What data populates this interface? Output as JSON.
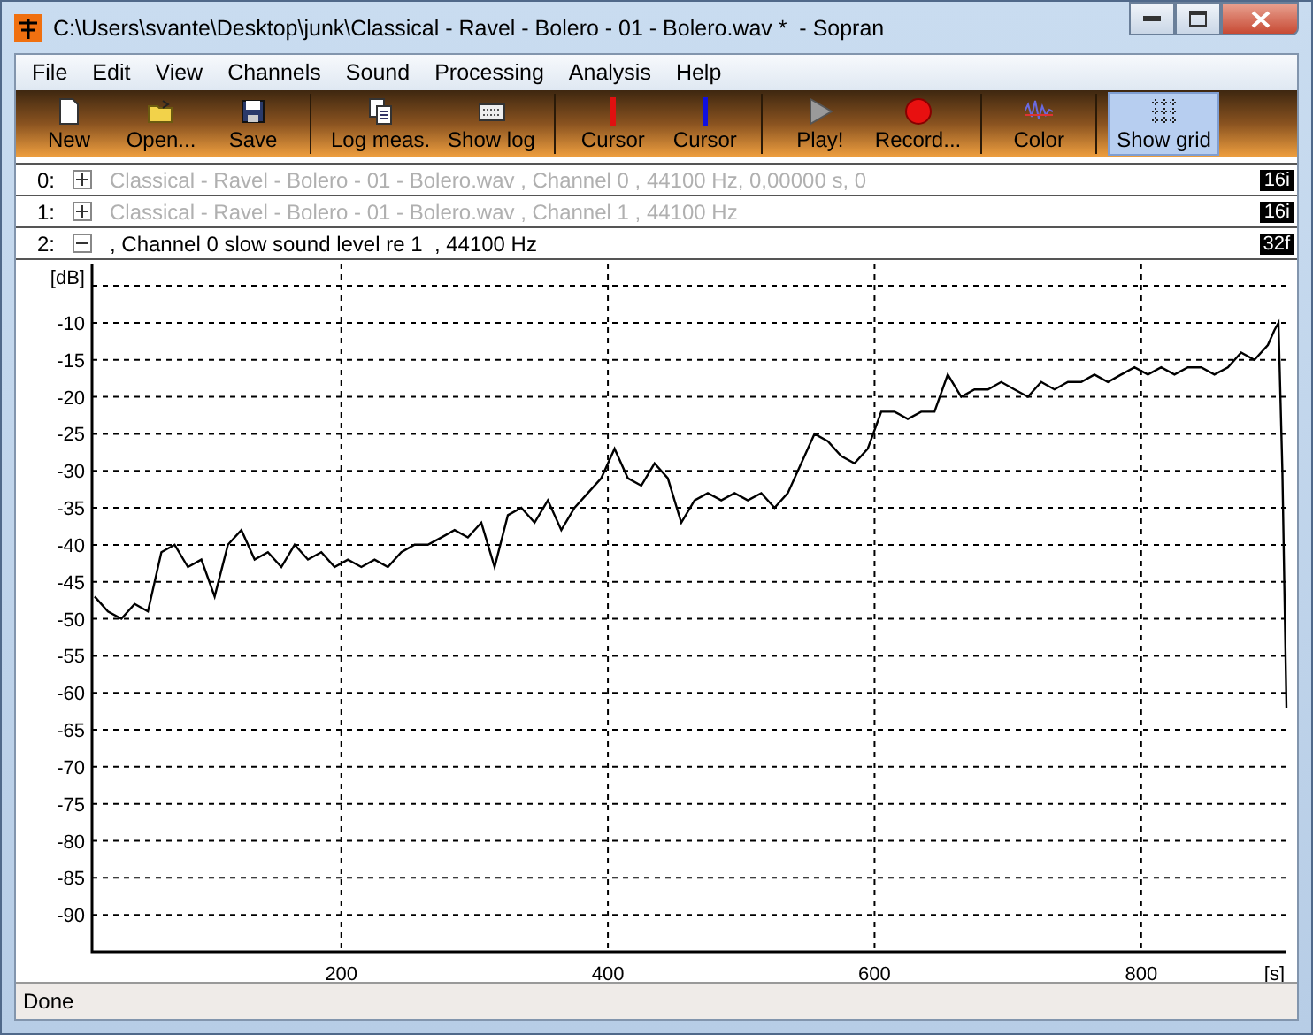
{
  "window": {
    "title": "C:\\Users\\svante\\Desktop\\junk\\Classical - Ravel - Bolero - 01 - Bolero.wav *  - Sopran"
  },
  "menu": [
    "File",
    "Edit",
    "View",
    "Channels",
    "Sound",
    "Processing",
    "Analysis",
    "Help"
  ],
  "toolbar": [
    [
      {
        "kind": "new",
        "label": "New",
        "on": false
      },
      {
        "kind": "open",
        "label": "Open...",
        "on": false
      },
      {
        "kind": "save",
        "label": "Save",
        "on": false
      }
    ],
    [
      {
        "kind": "log",
        "label": "Log meas.",
        "on": false
      },
      {
        "kind": "showlog",
        "label": "Show log",
        "on": false
      }
    ],
    [
      {
        "kind": "cursor",
        "label": "Cursor",
        "on": false,
        "color": "#e01010"
      },
      {
        "kind": "cursor",
        "label": "Cursor",
        "on": false,
        "color": "#1010e0"
      }
    ],
    [
      {
        "kind": "play",
        "label": "Play!",
        "on": false
      },
      {
        "kind": "record",
        "label": "Record...",
        "on": false
      }
    ],
    [
      {
        "kind": "color",
        "label": "Color",
        "on": false
      }
    ],
    [
      {
        "kind": "grid",
        "label": "Show grid",
        "on": true
      }
    ]
  ],
  "channels": [
    {
      "index": "0:",
      "expanded": false,
      "active": false,
      "description": "Classical - Ravel - Bolero - 01 - Bolero.wav , Channel 0 , 44100 Hz, 0,00000 s, 0",
      "format": "16i"
    },
    {
      "index": "1:",
      "expanded": false,
      "active": false,
      "description": "Classical - Ravel - Bolero - 01 - Bolero.wav , Channel 1 , 44100 Hz",
      "format": "16i"
    },
    {
      "index": "2:",
      "expanded": true,
      "active": true,
      "description": ", Channel 0 slow sound level re 1  , 44100 Hz",
      "format": "32f"
    }
  ],
  "plot": {
    "chart_data": {
      "type": "line",
      "grid": true,
      "xlim": [
        13,
        909
      ],
      "ylim": [
        -95,
        -2
      ],
      "xticks": [
        200,
        400,
        600,
        800,
        {
          "value": 900,
          "label": "[s]"
        }
      ],
      "yticks": [
        {
          "value": -5,
          "label": "[dB]"
        },
        -10,
        -15,
        -20,
        -25,
        -30,
        -35,
        -40,
        -45,
        -50,
        -55,
        -60,
        -65,
        -70,
        -75,
        -80,
        -85,
        -90
      ],
      "x": [
        15,
        25,
        35,
        45,
        55,
        65,
        75,
        85,
        95,
        105,
        115,
        125,
        135,
        145,
        155,
        165,
        175,
        185,
        195,
        205,
        215,
        225,
        235,
        245,
        255,
        265,
        275,
        285,
        295,
        305,
        315,
        325,
        335,
        345,
        355,
        365,
        375,
        385,
        395,
        405,
        415,
        425,
        435,
        445,
        455,
        465,
        475,
        485,
        495,
        505,
        515,
        525,
        535,
        545,
        555,
        565,
        575,
        585,
        595,
        605,
        615,
        625,
        635,
        645,
        655,
        665,
        675,
        685,
        695,
        705,
        715,
        725,
        735,
        745,
        755,
        765,
        775,
        785,
        795,
        805,
        815,
        825,
        835,
        845,
        855,
        865,
        875,
        885,
        895,
        900,
        903,
        906,
        909
      ],
      "series": [
        {
          "color": "#000000",
          "values": [
            -47,
            -49,
            -50,
            -48,
            -49,
            -41,
            -40,
            -43,
            -42,
            -47,
            -40,
            -38,
            -42,
            -41,
            -43,
            -40,
            -42,
            -41,
            -43,
            -42,
            -43,
            -42,
            -43,
            -41,
            -40,
            -40,
            -39,
            -38,
            -39,
            -37,
            -43,
            -36,
            -35,
            -37,
            -34,
            -38,
            -35,
            -33,
            -31,
            -27,
            -31,
            -32,
            -29,
            -31,
            -37,
            -34,
            -33,
            -34,
            -33,
            -34,
            -33,
            -35,
            -33,
            -29,
            -25,
            -26,
            -28,
            -29,
            -27,
            -22,
            -22,
            -23,
            -22,
            -22,
            -17,
            -20,
            -19,
            -19,
            -18,
            -19,
            -20,
            -18,
            -19,
            -18,
            -18,
            -17,
            -18,
            -17,
            -16,
            -17,
            -16,
            -17,
            -16,
            -16,
            -17,
            -16,
            -14,
            -15,
            -13,
            -11,
            -10,
            -30,
            -62
          ]
        }
      ]
    }
  },
  "status_bar": "Done"
}
